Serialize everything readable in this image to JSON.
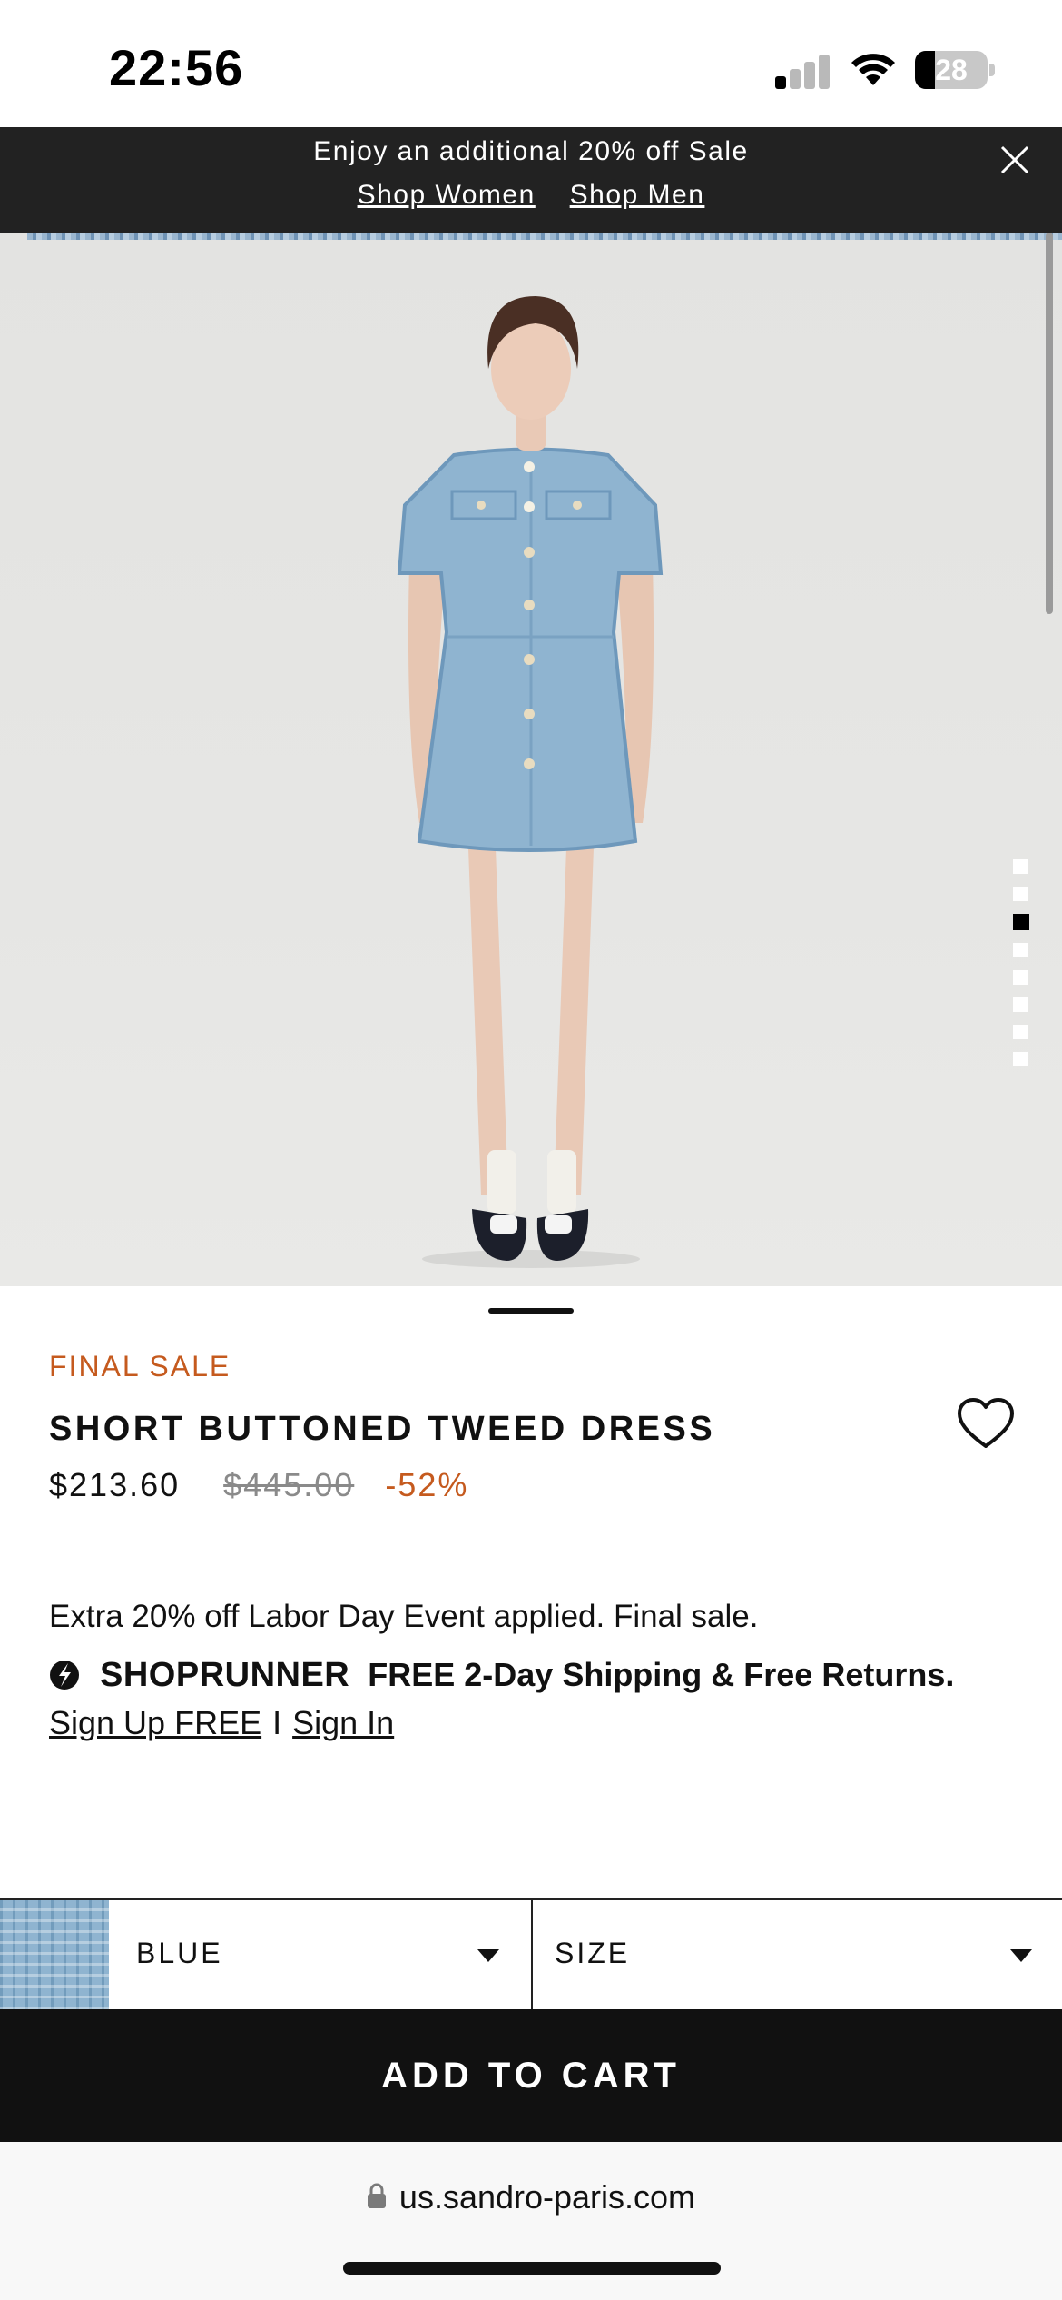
{
  "status_bar": {
    "time": "22:56",
    "battery_percent": "28",
    "battery_level": 0.28,
    "signal_bars_active": 1,
    "signal_bars_total": 4
  },
  "promo_banner": {
    "text": "Enjoy an additional 20% off Sale",
    "link_women": "Shop Women",
    "link_men": "Shop Men",
    "close_icon": "close-icon"
  },
  "gallery": {
    "image_count": 8,
    "active_index": 2,
    "subject": "model wearing blue tweed dress"
  },
  "product": {
    "badge": "FINAL SALE",
    "title": "SHORT BUTTONED TWEED DRESS",
    "price_current": "$213.60",
    "price_original": "$445.00",
    "discount": "-52%",
    "wishlist_icon": "heart-outline-icon"
  },
  "promotion": {
    "applied_text": "Extra 20% off Labor Day Event applied. Final sale."
  },
  "shoprunner": {
    "brand": "SHOPRUNNER",
    "shipping_text": "FREE 2-Day Shipping & Free Returns.",
    "sign_up": "Sign Up FREE",
    "separator": "I",
    "sign_in": "Sign In"
  },
  "selectors": {
    "color_label": "BLUE",
    "size_label": "SIZE"
  },
  "cart": {
    "add_to_cart_label": "ADD TO CART"
  },
  "browser": {
    "url": "us.sandro-paris.com"
  },
  "colors": {
    "accent_orange": "#c55a1e",
    "banner_bg": "#222222",
    "button_bg": "#111111",
    "dress_blue": "#8fb4d0"
  }
}
